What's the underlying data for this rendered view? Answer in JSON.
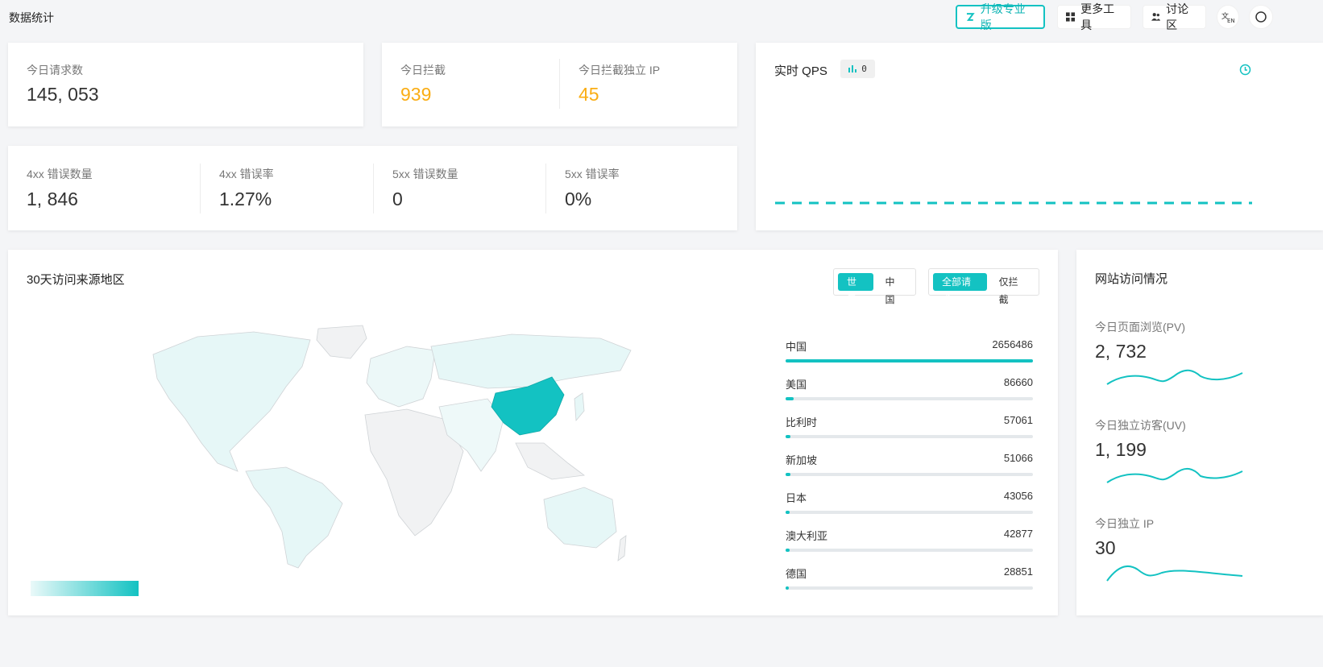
{
  "header": {
    "title": "数据统计",
    "buttons": {
      "upgrade": "升级专业版",
      "tools": "更多工具",
      "forum": "讨论区"
    }
  },
  "today_requests": {
    "label": "今日请求数",
    "value": "145, 053"
  },
  "today_block": {
    "label": "今日拦截",
    "value": "939"
  },
  "today_block_ip": {
    "label": "今日拦截独立 IP",
    "value": "45"
  },
  "errors": {
    "e4xx_count": {
      "label": "4xx 错误数量",
      "value": "1, 846"
    },
    "e4xx_rate": {
      "label": "4xx 错误率",
      "value": "1.27%"
    },
    "e5xx_count": {
      "label": "5xx 错误数量",
      "value": "0"
    },
    "e5xx_rate": {
      "label": "5xx 错误率",
      "value": "0%"
    }
  },
  "qps": {
    "title": "实时 QPS",
    "badge": "0"
  },
  "region": {
    "title": "30天访问来源地区",
    "scope_tabs": [
      "世界",
      "中国"
    ],
    "filter_tabs": [
      "全部请求",
      "仅拦截"
    ],
    "ranking": [
      {
        "name": "中国",
        "count": "2656486",
        "fraction": 1.0
      },
      {
        "name": "美国",
        "count": "86660",
        "fraction": 0.033
      },
      {
        "name": "比利时",
        "count": "57061",
        "fraction": 0.021
      },
      {
        "name": "新加坡",
        "count": "51066",
        "fraction": 0.019
      },
      {
        "name": "日本",
        "count": "43056",
        "fraction": 0.016
      },
      {
        "name": "澳大利亚",
        "count": "42877",
        "fraction": 0.016
      },
      {
        "name": "德国",
        "count": "28851",
        "fraction": 0.011
      }
    ]
  },
  "visits": {
    "title": "网站访问情况",
    "pv": {
      "label": "今日页面浏览(PV)",
      "value": "2, 732"
    },
    "uv": {
      "label": "今日独立访客(UV)",
      "value": "1, 199"
    },
    "ip": {
      "label": "今日独立 IP",
      "value": "30"
    }
  },
  "colors": {
    "accent": "#13c2c2",
    "warning": "#faad14"
  }
}
